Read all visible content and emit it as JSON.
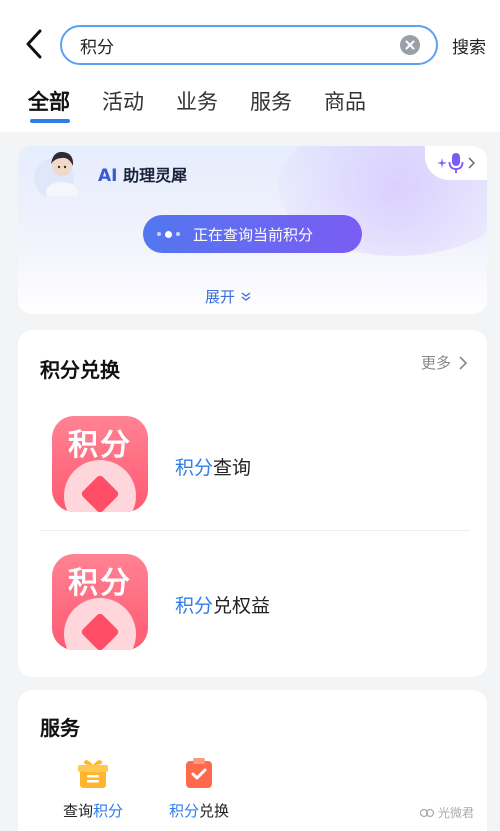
{
  "search": {
    "query": "积分",
    "submit_label": "搜索"
  },
  "tabs": [
    {
      "label": "全部",
      "active": true
    },
    {
      "label": "活动",
      "active": false
    },
    {
      "label": "业务",
      "active": false
    },
    {
      "label": "服务",
      "active": false
    },
    {
      "label": "商品",
      "active": false
    }
  ],
  "assistant": {
    "name_prefix": "AI",
    "name": "助理灵犀",
    "status_text": "正在查询当前积分",
    "expand_label": "展开"
  },
  "points_exchange": {
    "title": "积分兑换",
    "more_label": "更多",
    "icon_text": "积分",
    "items": [
      {
        "highlight": "积分",
        "rest": "查询"
      },
      {
        "highlight": "积分",
        "rest": "兑权益"
      }
    ]
  },
  "services": {
    "title": "服务",
    "items": [
      {
        "prefix": "查询",
        "highlight": "积分",
        "suffix": ""
      },
      {
        "prefix": "",
        "highlight": "积分",
        "suffix": "兑换"
      }
    ]
  },
  "watermark": "光微君",
  "colors": {
    "accent": "#2f7dea",
    "search_border": "#5aa2ef",
    "pill_start": "#5277f0",
    "pill_end": "#7b5cf3",
    "points_icon": "#ff5971"
  }
}
